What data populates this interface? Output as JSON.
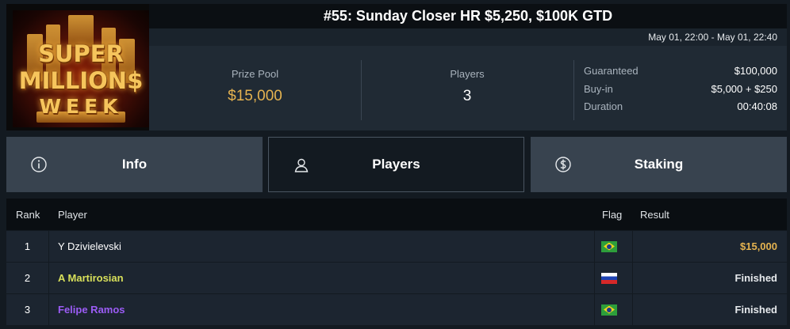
{
  "logo": {
    "line1": "SUPER",
    "line2": "MILLION$",
    "line3": "WEEK"
  },
  "tournament": {
    "title": "#55: Sunday Closer HR $5,250, $100K GTD",
    "dates": "May 01, 22:00 - May 01, 22:40"
  },
  "stats": {
    "prize_pool_label": "Prize Pool",
    "prize_pool_value": "$15,000",
    "players_label": "Players",
    "players_value": "3",
    "guaranteed_label": "Guaranteed",
    "guaranteed_value": "$100,000",
    "buyin_label": "Buy-in",
    "buyin_value": "$5,000 + $250",
    "duration_label": "Duration",
    "duration_value": "00:40:08"
  },
  "tabs": [
    {
      "label": "Info",
      "icon": "info-icon"
    },
    {
      "label": "Players",
      "icon": "user-icon"
    },
    {
      "label": "Staking",
      "icon": "dollar-coin-icon"
    }
  ],
  "active_tab": "Players",
  "table": {
    "headers": {
      "rank": "Rank",
      "player": "Player",
      "flag": "Flag",
      "result": "Result"
    },
    "rows": [
      {
        "rank": "1",
        "player": "Y Dzivielevski",
        "flag": "brazil-flag",
        "result": "$15,000"
      },
      {
        "rank": "2",
        "player": "A Martirosian",
        "flag": "russia-flag",
        "result": "Finished"
      },
      {
        "rank": "3",
        "player": "Felipe Ramos",
        "flag": "brazil-flag",
        "result": "Finished"
      }
    ]
  },
  "colors": {
    "gold": "#e5b350",
    "player2": "#d8e05a",
    "player3": "#9b5cf5",
    "background": "#131a21"
  }
}
